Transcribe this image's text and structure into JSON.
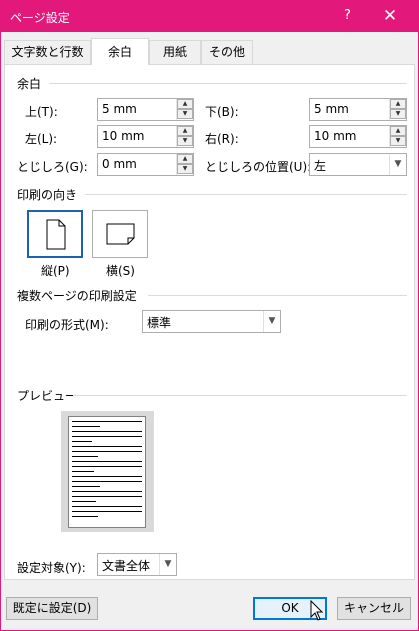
{
  "window": {
    "title": "ページ設定",
    "help_label": "?",
    "close_label": "✕"
  },
  "tabs": [
    {
      "label": "文字数と行数",
      "active": false
    },
    {
      "label": "余白",
      "active": true
    },
    {
      "label": "用紙",
      "active": false
    },
    {
      "label": "その他",
      "active": false
    }
  ],
  "margins": {
    "section_label": "余白",
    "top": {
      "label": "上(T):",
      "value": "5 mm"
    },
    "bottom": {
      "label": "下(B):",
      "value": "5 mm"
    },
    "left": {
      "label": "左(L):",
      "value": "10 mm"
    },
    "right": {
      "label": "右(R):",
      "value": "10 mm"
    },
    "gutter": {
      "label": "とじしろ(G):",
      "value": "0 mm"
    },
    "gutter_position": {
      "label": "とじしろの位置(U):",
      "value": "左"
    }
  },
  "orientation": {
    "section_label": "印刷の向き",
    "portrait_label": "縦(P)",
    "landscape_label": "横(S)",
    "selected": "portrait"
  },
  "multiple_pages": {
    "section_label": "複数ページの印刷設定",
    "format_label": "印刷の形式(M):",
    "format_value": "標準"
  },
  "preview": {
    "section_label": "プレビュー"
  },
  "apply_to": {
    "label": "設定対象(Y):",
    "value": "文書全体"
  },
  "buttons": {
    "set_default": "既定に設定(D)",
    "ok": "OK",
    "cancel": "キャンセル"
  },
  "colors": {
    "titlebar": "#e2197b",
    "accent": "#0078d7"
  }
}
